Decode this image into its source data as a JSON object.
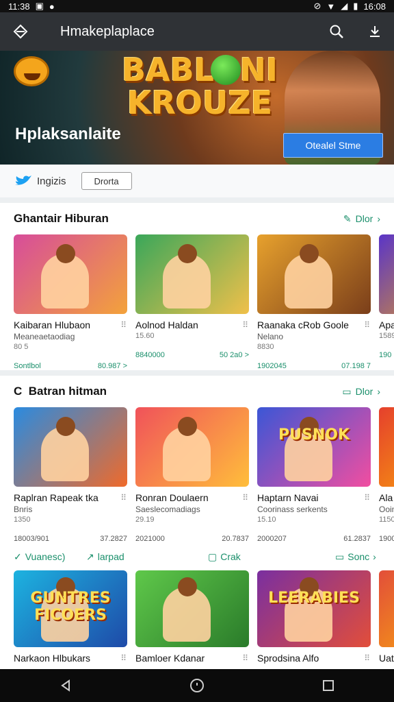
{
  "status": {
    "time_left": "11:38",
    "time_right": "16:08"
  },
  "appbar": {
    "title": "Hmakeplaplace"
  },
  "hero": {
    "brand": "Hplaksanlaite",
    "logo_line1": "BABLONI",
    "logo_line2": "KROUZE",
    "cta": "Otealel Stme"
  },
  "filters": {
    "label": "Ingizis",
    "chip": "Drorta"
  },
  "section1": {
    "title": "Ghantair Hiburan",
    "more": "Dlor",
    "cards": [
      {
        "title": "Kaibaran Hlubaon",
        "sub": "Meaneaetaodiag",
        "sub2": "80 5",
        "meta_left": "Sontlbol",
        "meta_right": "80.987 >",
        "colors": [
          "#d74d9a",
          "#f3a23b"
        ]
      },
      {
        "title": "Aolnod Haldan",
        "sub": "",
        "sub2": "15.60",
        "meta_left": "8840000",
        "meta_right": "50 2a0 >",
        "colors": [
          "#3aa75a",
          "#f0c04a"
        ]
      },
      {
        "title": "Raanaka cRob Goole",
        "sub": "Nelano",
        "sub2": "8830",
        "meta_left": "1902045",
        "meta_right": "07.198 7",
        "colors": [
          "#e7a12d",
          "#7a3e1a"
        ]
      },
      {
        "title": "Apa",
        "sub": "",
        "sub2": "1589",
        "meta_left": "190",
        "meta_right": "",
        "colors": [
          "#5a35c8",
          "#ffb000"
        ]
      }
    ]
  },
  "section2": {
    "title": "Batran hitman",
    "more": "Dlor",
    "cards": [
      {
        "title": "Raplran Rapeak tka",
        "sub": "Bnris",
        "sub2": "1350",
        "meta_left": "18003/901",
        "meta_right": "37.2827",
        "colors": [
          "#2a8be0",
          "#f06a2a"
        ]
      },
      {
        "title": "Ronran Doulaern",
        "sub": "Saeslecomadiags",
        "sub2": "29.19",
        "meta_left": "2021000",
        "meta_right": "20.7837",
        "colors": [
          "#f0525a",
          "#ffbe3b"
        ]
      },
      {
        "title": "Haptarn Navai",
        "sub": "Coorinass serkents",
        "sub2": "15.10",
        "meta_left": "2000207",
        "meta_right": "61.2837",
        "colors": [
          "#3b56d6",
          "#f24ea0"
        ]
      },
      {
        "title": "Ala",
        "sub": "Ooin",
        "sub2": "1150",
        "meta_left": "1900",
        "meta_right": "",
        "colors": [
          "#e5402d",
          "#ffc200"
        ]
      }
    ],
    "card3_banner": "PUSNOK",
    "actions": {
      "a1": "Vuanesc)",
      "a2": "larpad",
      "a3": "Crak",
      "a4": "Sonc"
    }
  },
  "section3": {
    "cards": [
      {
        "title": "Narkaon Hlbukars",
        "banner": "GUNTRES FICOERS",
        "colors": [
          "#1db3e0",
          "#1e4aa8"
        ]
      },
      {
        "title": "Bamloer Kdanar",
        "banner": "",
        "colors": [
          "#5fc84a",
          "#2a7b2a"
        ]
      },
      {
        "title": "Sprodsina Alfo",
        "banner": "LEERABIES",
        "colors": [
          "#7a2fa0",
          "#e24e3a"
        ]
      },
      {
        "title": "Uat",
        "banner": "",
        "colors": [
          "#e24e3a",
          "#ffc200"
        ]
      }
    ]
  }
}
